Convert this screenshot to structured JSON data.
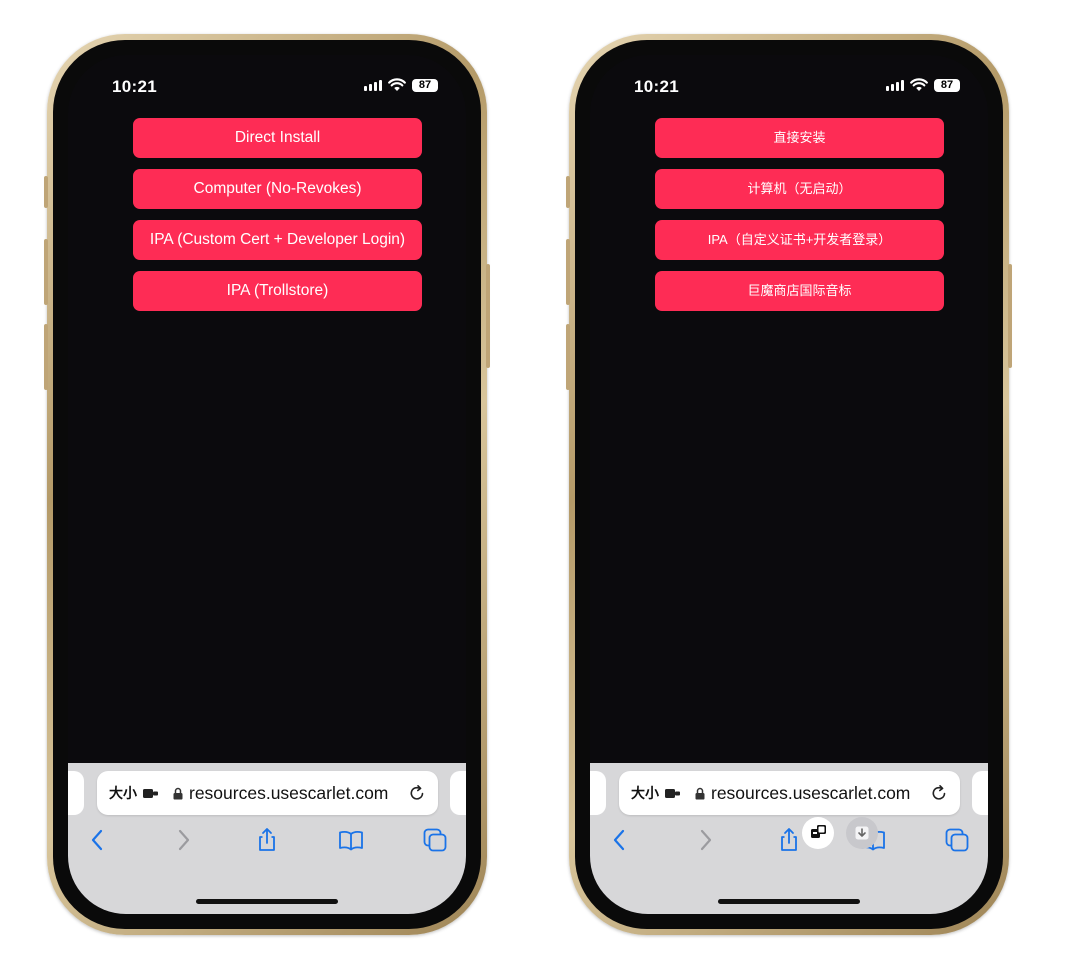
{
  "colors": {
    "accent": "#fe2c55",
    "screen_bg": "#0b0a0d",
    "toolbar_bg": "#d7d7d9",
    "icon_blue": "#1a73e8"
  },
  "left_phone": {
    "status": {
      "time": "10:21",
      "battery": "87"
    },
    "buttons": [
      "Direct Install",
      "Computer (No-Revokes)",
      "IPA (Custom Cert + Developer Login)",
      "IPA (Trollstore)"
    ],
    "url_bar": {
      "aa": "大小",
      "url": "resources.usescarlet.com"
    }
  },
  "right_phone": {
    "status": {
      "time": "10:21",
      "battery": "87"
    },
    "buttons": [
      "直接安装",
      "计算机（无启动）",
      "IPA（自定义证书+开发者登录）",
      "巨魔商店国际音标"
    ],
    "url_bar": {
      "aa": "大小",
      "url": "resources.usescarlet.com"
    }
  },
  "icons": [
    "back-icon",
    "forward-icon",
    "share-icon",
    "bookmarks-icon",
    "tabs-icon",
    "reload-icon",
    "lock-icon",
    "extension-icon",
    "translate-icon",
    "download-icon"
  ]
}
